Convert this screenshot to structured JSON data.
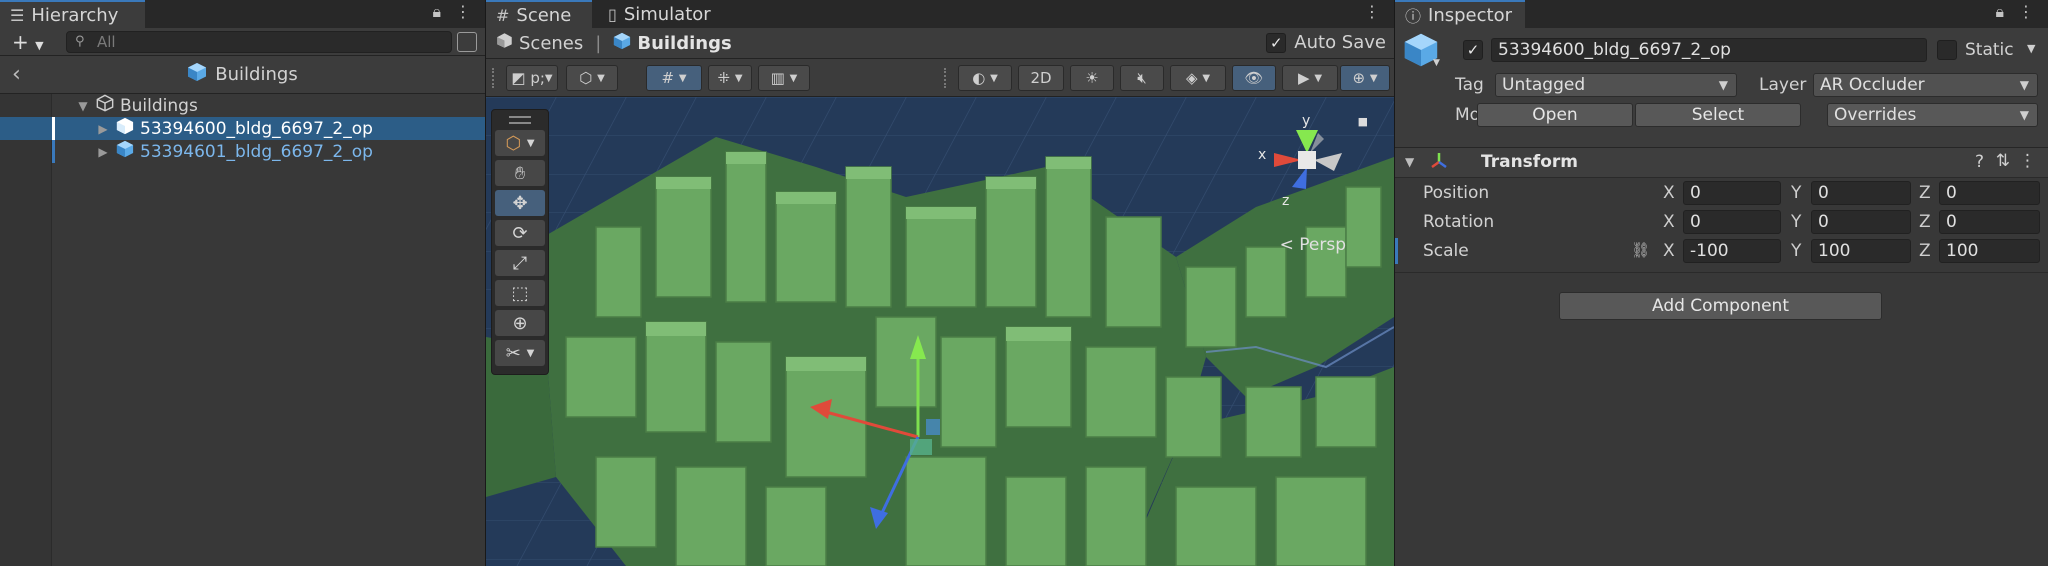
{
  "hierarchy": {
    "tab_label": "Hierarchy",
    "search_placeholder": "All",
    "breadcrumb_label": "Buildings",
    "tree": [
      {
        "label": "Buildings",
        "icon": "gameobject-icon",
        "expanded": true,
        "selected": false,
        "prefab": false
      },
      {
        "label": "53394600_bldg_6697_2_op",
        "icon": "prefab-icon",
        "expanded": false,
        "selected": true,
        "prefab": true
      },
      {
        "label": "53394601_bldg_6697_2_op",
        "icon": "prefab-icon",
        "expanded": false,
        "selected": false,
        "prefab": true
      }
    ]
  },
  "scene": {
    "tabs": [
      {
        "label": "Scene",
        "icon": "grid-icon",
        "active": true
      },
      {
        "label": "Simulator",
        "icon": "device-icon",
        "active": false
      }
    ],
    "breadcrumb": {
      "root": "Scenes",
      "current": "Buildings"
    },
    "auto_save_label": "Auto Save",
    "auto_save_checked": true,
    "toolbar": {
      "mode_2d_label": "2D"
    },
    "gizmo": {
      "x_label": "x",
      "y_label": "y",
      "z_label": "z",
      "projection_label": "Persp"
    }
  },
  "inspector": {
    "tab_label": "Inspector",
    "object_name": "53394600_bldg_6697_2_op",
    "active_checked": true,
    "static_label": "Static",
    "static_checked": false,
    "tag_label": "Tag",
    "tag_value": "Untagged",
    "layer_label": "Layer",
    "layer_value": "AR Occluder",
    "model_label": "Model",
    "open_label": "Open",
    "select_label": "Select",
    "overrides_label": "Overrides",
    "transform": {
      "title": "Transform",
      "position": {
        "label": "Position",
        "x": "0",
        "y": "0",
        "z": "0"
      },
      "rotation": {
        "label": "Rotation",
        "x": "0",
        "y": "0",
        "z": "0"
      },
      "scale": {
        "label": "Scale",
        "x": "-100",
        "y": "100",
        "z": "100"
      }
    },
    "axis_labels": {
      "x": "X",
      "y": "Y",
      "z": "Z"
    },
    "add_component_label": "Add Component"
  },
  "colors": {
    "accent": "#3a79bb",
    "selection": "#2c5d87",
    "prefab_text": "#7cb7ec",
    "viewport_bg": "#243a59",
    "building_green": "#5f9a57"
  }
}
